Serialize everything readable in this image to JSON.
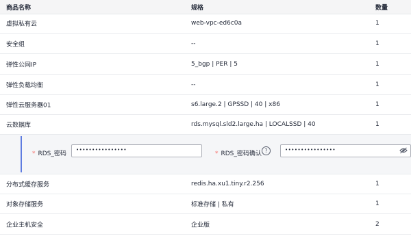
{
  "columns": {
    "name": "商品名称",
    "spec": "规格",
    "qty": "数量"
  },
  "rows": [
    {
      "name": "虚拟私有云",
      "spec": "web-vpc-ed6c0a",
      "qty": "1"
    },
    {
      "name": "安全组",
      "spec": "--",
      "qty": "1"
    },
    {
      "name": "弹性公网IP",
      "spec": "5_bgp | PER | 5",
      "qty": "1"
    },
    {
      "name": "弹性负载均衡",
      "spec": "--",
      "qty": "1"
    },
    {
      "name": "弹性云服务器01",
      "spec": "s6.large.2 | GPSSD | 40 | x86",
      "qty": "1"
    },
    {
      "name": "云数据库",
      "spec": "rds.mysql.sld2.large.ha | LOCALSSD | 40",
      "qty": "1"
    },
    {
      "name": "分布式缓存服务",
      "spec": "redis.ha.xu1.tiny.r2.256",
      "qty": "1"
    },
    {
      "name": "对象存储服务",
      "spec": "标准存储 | 私有",
      "qty": "1"
    },
    {
      "name": "企业主机安全",
      "spec": "企业版",
      "qty": "2"
    }
  ],
  "form": {
    "required_mark": "*",
    "password_label": "RDS_密码",
    "password_value": "••••••••••••••••",
    "confirm_label": "RDS_密码确认",
    "confirm_value": "••••••••••••••••",
    "help_icon": "question-circle-icon",
    "visibility_icon": "eye-off-icon"
  },
  "colors": {
    "required": "#f66f6a",
    "accent_bar": "#5e7ce0",
    "header_bg": "#f5f5f6"
  }
}
